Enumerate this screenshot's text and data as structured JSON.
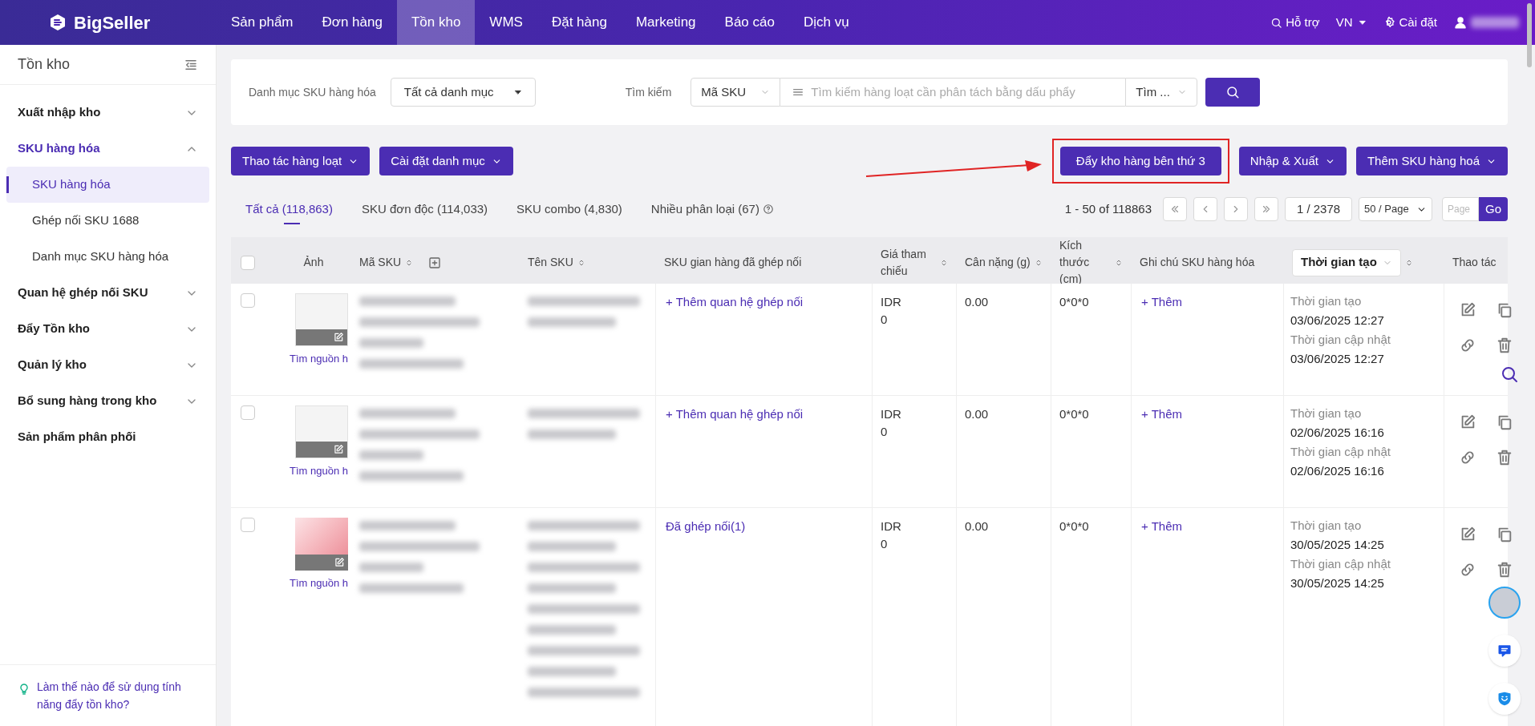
{
  "header": {
    "logo": "BigSeller",
    "nav": [
      {
        "label": "Sản phẩm",
        "selected": false
      },
      {
        "label": "Đơn hàng",
        "selected": false
      },
      {
        "label": "Tồn kho",
        "selected": true
      },
      {
        "label": "WMS",
        "selected": false
      },
      {
        "label": "Đặt hàng",
        "selected": false
      },
      {
        "label": "Marketing",
        "selected": false
      },
      {
        "label": "Báo cáo",
        "selected": false
      },
      {
        "label": "Dịch vụ",
        "selected": false
      }
    ],
    "support": "Hỗ trợ",
    "language": "VN",
    "settings": "Cài đặt"
  },
  "sidebar": {
    "title": "Tồn kho",
    "items": [
      {
        "label": "Xuất nhập kho",
        "expanded": false,
        "has_children": true
      },
      {
        "label": "SKU hàng hóa",
        "expanded": true,
        "has_children": true,
        "children": [
          {
            "label": "SKU hàng hóa",
            "selected": true
          },
          {
            "label": "Ghép nối SKU 1688",
            "selected": false
          },
          {
            "label": "Danh mục SKU hàng hóa",
            "selected": false
          }
        ]
      },
      {
        "label": "Quan hệ ghép nối SKU",
        "expanded": false,
        "has_children": true
      },
      {
        "label": "Đẩy Tồn kho",
        "expanded": false,
        "has_children": true
      },
      {
        "label": "Quản lý kho",
        "expanded": false,
        "has_children": true
      },
      {
        "label": "Bổ sung hàng trong kho",
        "expanded": false,
        "has_children": true
      },
      {
        "label": "Sản phẩm phân phối",
        "expanded": false,
        "has_children": false
      }
    ],
    "help": "Làm thế nào để sử dụng tính năng đẩy tồn kho?"
  },
  "filters": {
    "category_label": "Danh mục SKU hàng hóa",
    "category_value": "Tất cả danh mục",
    "search_label": "Tìm kiếm",
    "search_type": "Mã SKU",
    "search_placeholder": "Tìm kiếm hàng loạt cần phân tách bằng dấu phẩy",
    "search_mode": "Tìm ..."
  },
  "toolbar": {
    "left": [
      "Thao tác hàng loạt",
      "Cài đặt danh mục"
    ],
    "highlighted": "Đẩy kho hàng bên thứ 3",
    "right": [
      "Nhập & Xuất",
      "Thêm SKU hàng hoá"
    ]
  },
  "tabs": [
    {
      "label": "Tất cả (118,863)",
      "selected": true,
      "help": false
    },
    {
      "label": "SKU đơn độc (114,033)",
      "selected": false,
      "help": false
    },
    {
      "label": "SKU combo (4,830)",
      "selected": false,
      "help": false
    },
    {
      "label": "Nhiều phân loại (67)",
      "selected": false,
      "help": true
    }
  ],
  "pagination": {
    "range": "1 - 50 of 118863",
    "page": "1 / 2378",
    "page_size": "50 / Page",
    "page_placeholder": "Page",
    "go": "Go"
  },
  "table": {
    "select_all_checked": false,
    "columns": [
      {
        "label": "Ảnh",
        "sortable": false,
        "kind": "text"
      },
      {
        "label": "Mã SKU",
        "sortable": true,
        "kind": "expand"
      },
      {
        "label": "Tên SKU",
        "sortable": true,
        "kind": "text"
      },
      {
        "label": "SKU gian hàng đã ghép nối",
        "sortable": false,
        "kind": "text"
      },
      {
        "label": "Giá tham chiếu",
        "sortable": true,
        "kind": "text"
      },
      {
        "label": "Cân nặng (g)",
        "sortable": true,
        "kind": "text"
      },
      {
        "label": "Kích thước (cm)",
        "sortable": true,
        "kind": "text"
      },
      {
        "label": "Ghi chú SKU hàng hóa",
        "sortable": false,
        "kind": "text"
      },
      {
        "label": "Thời gian tạo",
        "sortable": true,
        "kind": "select"
      },
      {
        "label": "Thao tác",
        "sortable": false,
        "kind": "text"
      }
    ],
    "rows": [
      {
        "checked": false,
        "kind": "placeholder",
        "source": "Tìm nguồn h",
        "link": "+ Thêm quan hệ ghép nối",
        "currency": "IDR",
        "price": "0",
        "weight": "0.00",
        "size": "0*0*0",
        "note": "+ Thêm",
        "created_label": "Thời gian tạo",
        "created": "03/06/2025 12:27",
        "updated_label": "Thời gian cập nhật",
        "updated": "03/06/2025 12:27"
      },
      {
        "checked": false,
        "kind": "placeholder",
        "source": "Tìm nguồn h",
        "link": "+ Thêm quan hệ ghép nối",
        "currency": "IDR",
        "price": "0",
        "weight": "0.00",
        "size": "0*0*0",
        "note": "+ Thêm",
        "created_label": "Thời gian tạo",
        "created": "02/06/2025 16:16",
        "updated_label": "Thời gian cập nhật",
        "updated": "02/06/2025 16:16"
      },
      {
        "checked": false,
        "kind": "photo",
        "source": "Tìm nguồn h",
        "link": "Đã ghép nối(1)",
        "currency": "IDR",
        "price": "0",
        "weight": "0.00",
        "size": "0*0*0",
        "note": "+ Thêm",
        "created_label": "Thời gian tạo",
        "created": "30/05/2025 14:25",
        "updated_label": "Thời gian cập nhật",
        "updated": "30/05/2025 14:25"
      }
    ]
  }
}
